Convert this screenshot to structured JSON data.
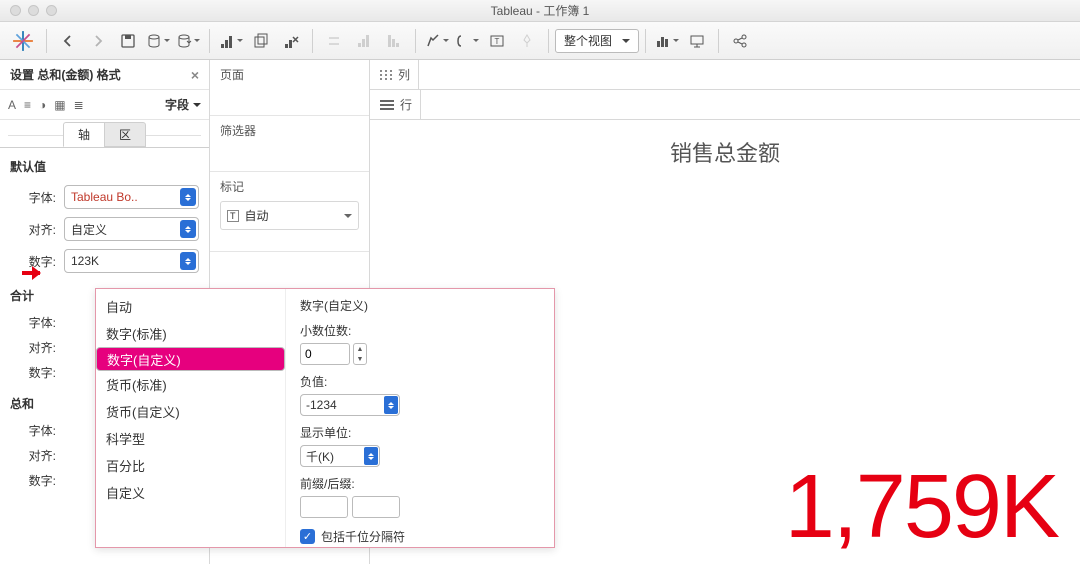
{
  "window": {
    "title": "Tableau - 工作簿 1"
  },
  "toolbar": {
    "view_mode": "整个视图"
  },
  "format_pane": {
    "title": "设置 总和(金额) 格式",
    "field_label": "字段",
    "tabs": {
      "axis": "轴",
      "pane": "区"
    },
    "sections": {
      "default": "默认值",
      "total": "合计",
      "grand_total": "总和"
    },
    "rows": {
      "font": "字体:",
      "font_val": "Tableau Bo..",
      "align": "对齐:",
      "align_val": "自定义",
      "number": "数字:",
      "number_val": "123K"
    }
  },
  "shelves": {
    "pages": "页面",
    "filters": "筛选器",
    "marks": "标记",
    "mark_type": "自动",
    "columns": "列",
    "rows": "行"
  },
  "popup": {
    "title": "数字(自定义)",
    "list": [
      "自动",
      "数字(标准)",
      "数字(自定义)",
      "货币(标准)",
      "货币(自定义)",
      "科学型",
      "百分比",
      "自定义"
    ],
    "selected_index": 2,
    "decimals_label": "小数位数:",
    "decimals": "0",
    "neg_label": "负值:",
    "neg_val": "-1234",
    "unit_label": "显示单位:",
    "unit_val": "千(K)",
    "prefix_label": "前缀/后缀:",
    "sep_label": "包括千位分隔符"
  },
  "viz": {
    "title": "销售总金额",
    "value": "1,759K"
  }
}
